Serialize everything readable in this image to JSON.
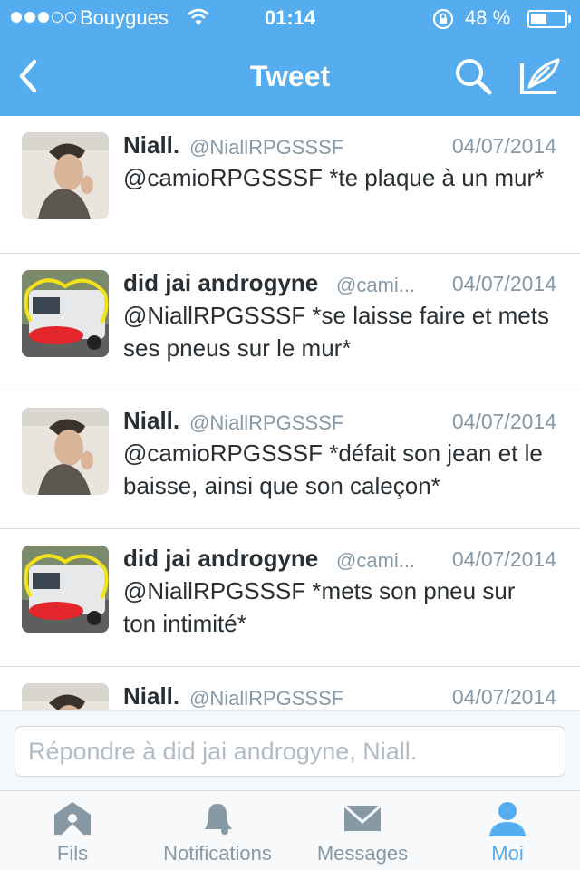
{
  "status_bar": {
    "carrier": "Bouygues",
    "time": "01:14",
    "battery": "48 %",
    "battery_level": 0.48
  },
  "nav": {
    "back_icon": "chevron-left-icon",
    "title": "Tweet",
    "search_icon": "search-icon",
    "compose_icon": "compose-feather-icon"
  },
  "tweets": [
    {
      "name": "Niall.",
      "handle": "@NiallRPGSSSF",
      "date": "04/07/2014",
      "text": "@camioRPGSSSF *te plaque à un mur*"
    },
    {
      "name": "did jai androgyne",
      "handle": "@cami...",
      "date": "04/07/2014",
      "text": "@NiallRPGSSSF *se laisse faire et mets ses pneus sur le mur*"
    },
    {
      "name": "Niall.",
      "handle": "@NiallRPGSSSF",
      "date": "04/07/2014",
      "text": "@camioRPGSSSF *défait son jean et le baisse, ainsi que son caleçon*"
    },
    {
      "name": "did jai androgyne",
      "handle": "@cami...",
      "date": "04/07/2014",
      "text": "@NiallRPGSSSF *mets son pneu sur ton intimité*"
    },
    {
      "name": "Niall.",
      "handle": "@NiallRPGSSSF",
      "date": "04/07/2014",
      "text": ""
    }
  ],
  "reply": {
    "placeholder": "Répondre à did jai androgyne, Niall."
  },
  "tabs": [
    {
      "label": "Fils",
      "icon": "home-icon",
      "active": false
    },
    {
      "label": "Notifications",
      "icon": "bell-icon",
      "active": false
    },
    {
      "label": "Messages",
      "icon": "envelope-icon",
      "active": false
    },
    {
      "label": "Moi",
      "icon": "person-icon",
      "active": true
    }
  ],
  "colors": {
    "brand": "#55acee",
    "text": "#292f33",
    "muted": "#8899a6"
  }
}
